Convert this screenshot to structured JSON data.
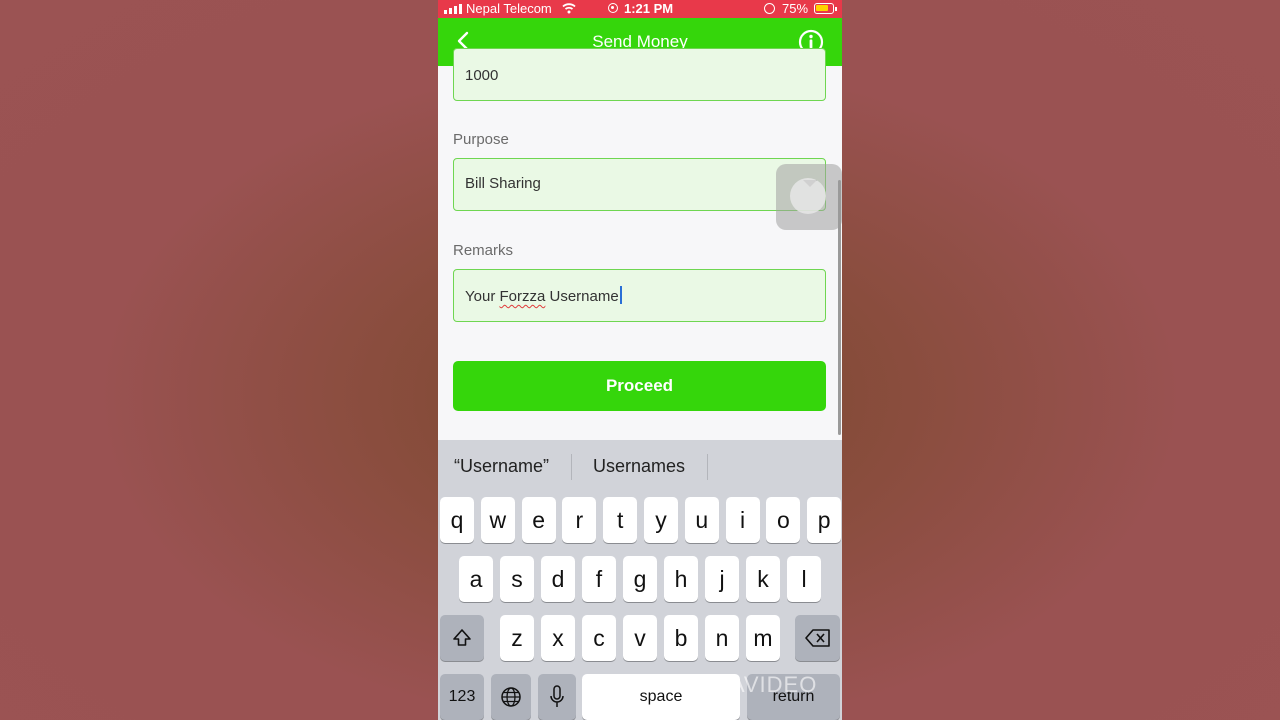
{
  "status_bar": {
    "carrier": "Nepal Telecom",
    "time": "1:21 PM",
    "battery": "75%"
  },
  "navbar": {
    "title": "Send Money",
    "back_icon": "chevron-left-icon",
    "info_icon": "info-icon"
  },
  "form": {
    "amount_value": "1000",
    "purpose_label": "Purpose",
    "purpose_value": "Bill Sharing",
    "remarks_label": "Remarks",
    "remarks_prefix": "Your ",
    "remarks_misspelled": "Forzza",
    "remarks_suffix": " Username",
    "proceed_label": "Proceed"
  },
  "keyboard": {
    "suggestions": [
      "“Username”",
      "Usernames"
    ],
    "row1": [
      "q",
      "w",
      "e",
      "r",
      "t",
      "y",
      "u",
      "i",
      "o",
      "p"
    ],
    "row2": [
      "a",
      "s",
      "d",
      "f",
      "g",
      "h",
      "j",
      "k",
      "l"
    ],
    "row3": [
      "z",
      "x",
      "c",
      "v",
      "b",
      "n",
      "m"
    ],
    "numbers_key": "123",
    "space_key": "space",
    "return_key": "return"
  },
  "watermark": "VIVAVIDEO",
  "colors": {
    "accent": "#35d60b",
    "status_bar": "#e8394a",
    "field_bg": "#eaf9e5"
  }
}
